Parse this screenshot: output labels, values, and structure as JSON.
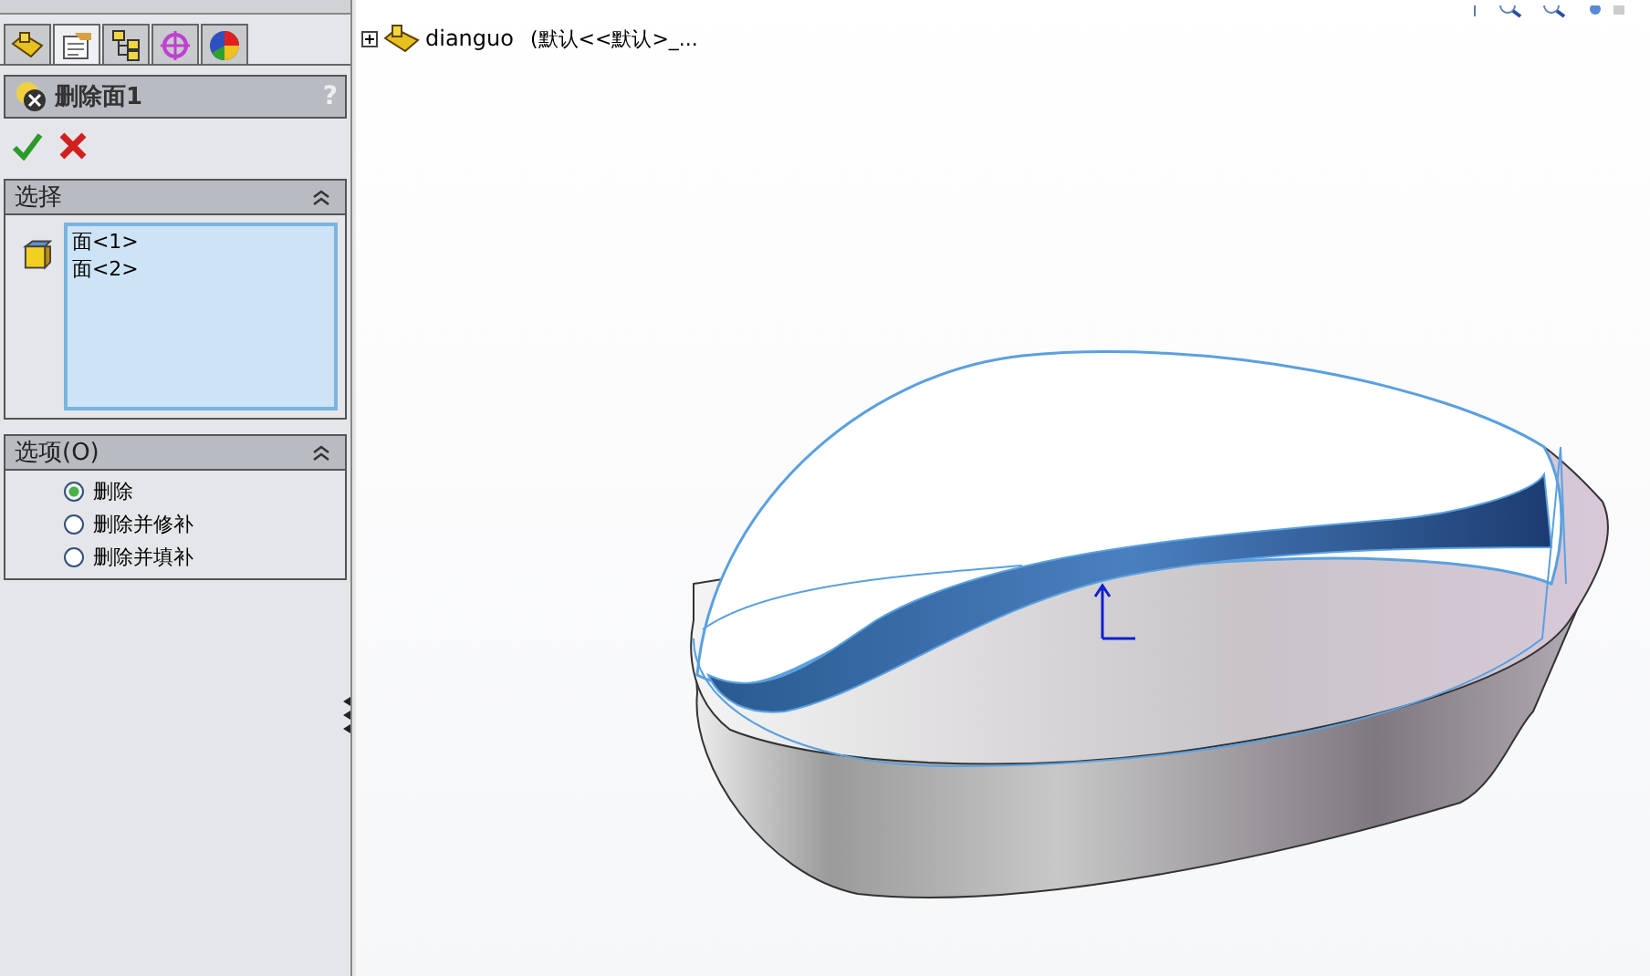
{
  "tabs": [
    {
      "kind": "feature",
      "selected": false
    },
    {
      "kind": "property",
      "selected": true
    },
    {
      "kind": "config",
      "selected": false
    },
    {
      "kind": "dimxpert",
      "selected": false
    },
    {
      "kind": "display",
      "selected": false
    }
  ],
  "feature": {
    "title": "删除面1",
    "help": "?"
  },
  "selection": {
    "title": "选择",
    "items": [
      "面<1>",
      "面<2>"
    ]
  },
  "options": {
    "title": "选项(O)",
    "items": [
      {
        "label": "删除",
        "selected": true
      },
      {
        "label": "删除并修补",
        "selected": false
      },
      {
        "label": "删除并填补",
        "selected": false
      }
    ]
  },
  "tree": {
    "name": "dianguo",
    "config": "(默认<<默认>_..."
  }
}
